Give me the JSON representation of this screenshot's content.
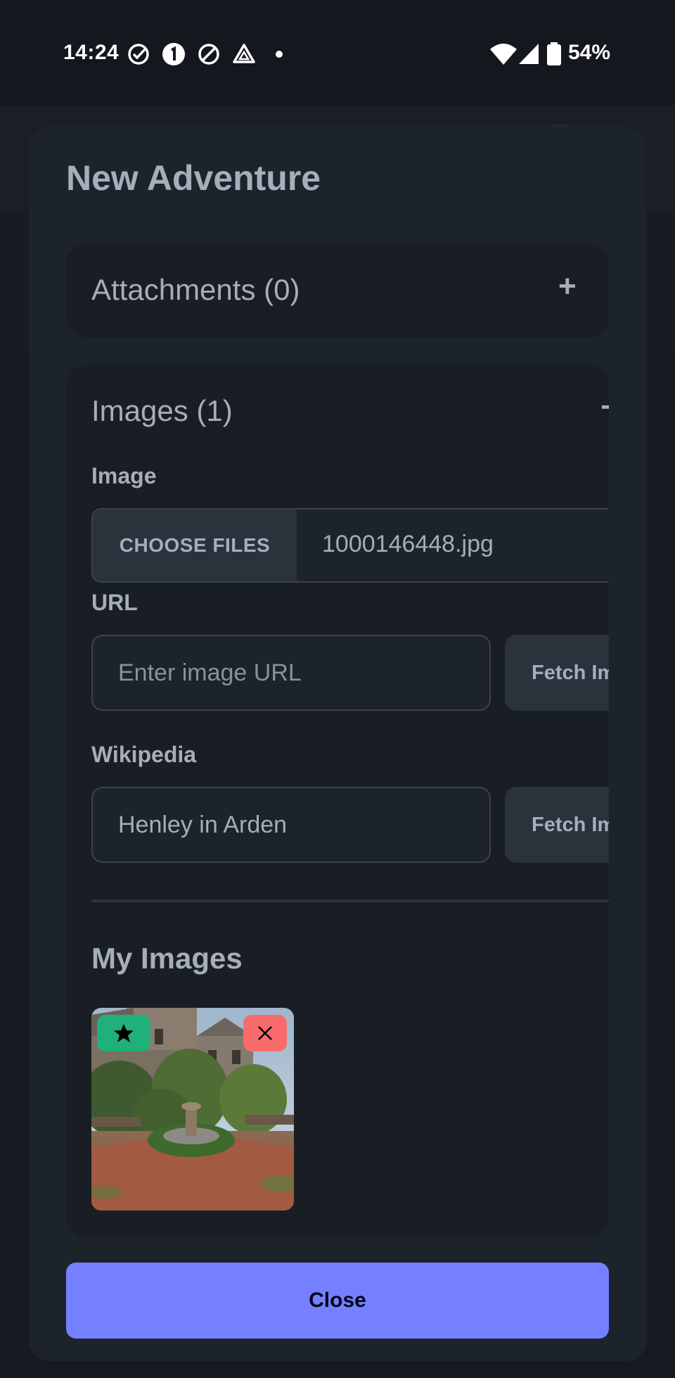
{
  "status_bar": {
    "time": "14:24",
    "battery": "54%",
    "icons": [
      "check-circle-icon",
      "badge-one-icon",
      "do-not-disturb-icon",
      "drive-icon",
      "dot-icon",
      "wifi-icon",
      "signal-icon",
      "battery-icon"
    ]
  },
  "modal": {
    "title": "New Adventure",
    "attachments": {
      "title": "Attachments (0)",
      "toggle": "+"
    },
    "images": {
      "title": "Images (1)",
      "toggle": "−",
      "image_label": "Image",
      "choose_files_label": "CHOOSE FILES",
      "file_name": "1000146448.jpg",
      "url_label": "URL",
      "url_placeholder": "Enter image URL",
      "url_value": "",
      "url_fetch_label": "Fetch Image",
      "wikipedia_label": "Wikipedia",
      "wikipedia_value": "Henley in Arden",
      "wikipedia_fetch_label": "Fetch Image",
      "my_images_title": "My Images",
      "thumbnail": {
        "star_icon": "star-icon",
        "delete_icon": "close-icon"
      }
    },
    "close_label": "Close"
  },
  "colors": {
    "modal_bg": "#1d232a",
    "panel_bg": "#191e24",
    "primary": "#7480ff",
    "success": "#1fb179",
    "error": "#f96b6b",
    "text": "#a6adbb"
  }
}
